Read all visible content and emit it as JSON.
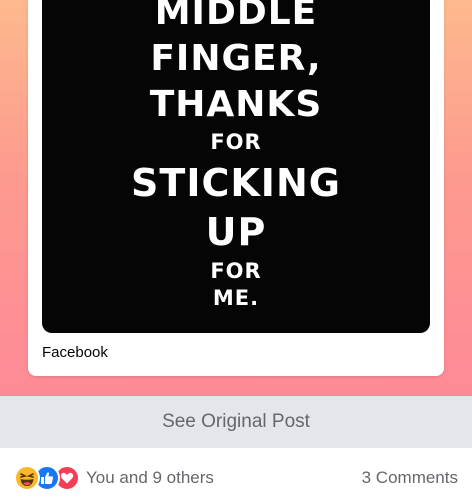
{
  "post_image": {
    "lines": [
      "MIDDLE",
      "FINGER,",
      "THANKS",
      "FOR",
      "STICKING",
      "UP",
      "FOR",
      "ME."
    ]
  },
  "shared_source": {
    "label": "Facebook"
  },
  "see_original": {
    "label": "See Original Post"
  },
  "footer": {
    "reactions": {
      "icons": [
        "haha-icon",
        "like-icon",
        "love-icon"
      ],
      "summary": "You and 9 others"
    },
    "comments_label": "3 Comments"
  },
  "colors": {
    "gradient_top": "#fdb98d",
    "gradient_bottom": "#fe8a97",
    "like_blue": "#1877f2",
    "love_red": "#f33e58",
    "haha_yellow": "#f7b928",
    "muted_text": "#65676b",
    "button_gray": "#e4e6eb"
  }
}
